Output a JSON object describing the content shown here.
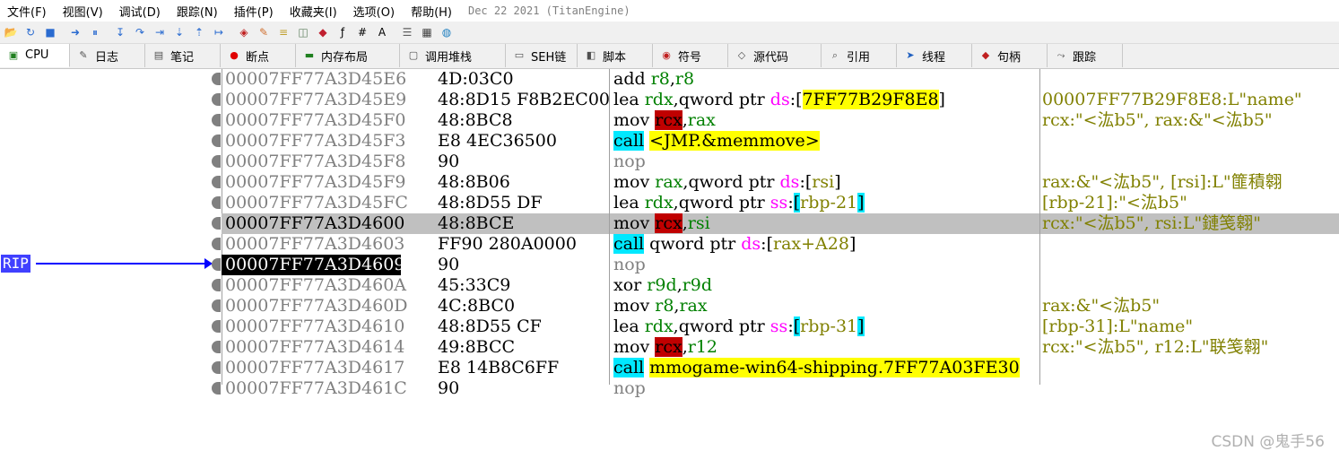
{
  "menu": {
    "items": [
      "文件(F)",
      "视图(V)",
      "调试(D)",
      "跟踪(N)",
      "插件(P)",
      "收藏夹(I)",
      "选项(O)",
      "帮助(H)"
    ],
    "title": "Dec 22 2021 (TitanEngine)"
  },
  "toolbar": {
    "icons": [
      "open-icon",
      "restart-icon",
      "stop-icon",
      "run-icon",
      "pause-icon",
      "step-into-icon",
      "step-over-icon",
      "trace-into-icon",
      "trace-over-icon",
      "execute-till-return-icon",
      "run-to-user-code-icon",
      "scylla-icon",
      "patch-icon",
      "comment-icon",
      "label-icon",
      "bookmark-icon",
      "function-icon",
      "hash-icon",
      "font-icon",
      "strings-icon",
      "calculator-icon",
      "globe-icon"
    ]
  },
  "tabs": [
    {
      "label": "CPU",
      "icon": "cpu-icon",
      "active": true
    },
    {
      "label": "日志",
      "icon": "log-icon",
      "active": false
    },
    {
      "label": "笔记",
      "icon": "notes-icon",
      "active": false
    },
    {
      "label": "断点",
      "icon": "breakpoint-icon",
      "active": false
    },
    {
      "label": "内存布局",
      "icon": "memory-icon",
      "active": false
    },
    {
      "label": "调用堆栈",
      "icon": "callstack-icon",
      "active": false
    },
    {
      "label": "SEH链",
      "icon": "seh-icon",
      "active": false
    },
    {
      "label": "脚本",
      "icon": "script-icon",
      "active": false
    },
    {
      "label": "符号",
      "icon": "symbols-icon",
      "active": false
    },
    {
      "label": "源代码",
      "icon": "source-icon",
      "active": false
    },
    {
      "label": "引用",
      "icon": "references-icon",
      "active": false
    },
    {
      "label": "线程",
      "icon": "threads-icon",
      "active": false
    },
    {
      "label": "句柄",
      "icon": "handles-icon",
      "active": false
    },
    {
      "label": "跟踪",
      "icon": "trace-icon",
      "active": false
    }
  ],
  "rip_label": "RIP",
  "rows": [
    {
      "addr": "00007FF77A3D45E6",
      "bytes": "4D:03C0",
      "dis": [
        [
          "mn",
          "add"
        ],
        [
          "sp",
          " "
        ],
        [
          "reg",
          "r8"
        ],
        [
          "pl",
          ","
        ],
        [
          "reg",
          "r8"
        ]
      ],
      "comment": ""
    },
    {
      "addr": "00007FF77A3D45E9",
      "bytes": "48:8D15 F8B2EC00",
      "dis": [
        [
          "mn",
          "lea"
        ],
        [
          "sp",
          " "
        ],
        [
          "reg",
          "rdx"
        ],
        [
          "pl",
          ","
        ],
        [
          "pl",
          "qword ptr "
        ],
        [
          "seg",
          "ds"
        ],
        [
          "pl",
          ":["
        ],
        [
          "imm",
          "7FF77B29F8E8"
        ],
        [
          "pl",
          "]"
        ]
      ],
      "comment": "00007FF77B29F8E8:L\"name\""
    },
    {
      "addr": "00007FF77A3D45F0",
      "bytes": "48:8BC8",
      "dis": [
        [
          "mn",
          "mov"
        ],
        [
          "sp",
          " "
        ],
        [
          "reghl",
          "rcx"
        ],
        [
          "pl",
          ","
        ],
        [
          "reg",
          "rax"
        ]
      ],
      "comment": "rcx:\"<汯b5\", rax:&\"<汯b5\""
    },
    {
      "addr": "00007FF77A3D45F3",
      "bytes": "E8 4EC36500",
      "dis": [
        [
          "call",
          "call"
        ],
        [
          "sp",
          " "
        ],
        [
          "sym",
          "<JMP.&memmove>"
        ]
      ],
      "comment": ""
    },
    {
      "addr": "00007FF77A3D45F8",
      "bytes": "90",
      "dis": [
        [
          "nop",
          "nop"
        ]
      ],
      "comment": ""
    },
    {
      "addr": "00007FF77A3D45F9",
      "bytes": "48:8B06",
      "dis": [
        [
          "mn",
          "mov"
        ],
        [
          "sp",
          " "
        ],
        [
          "reg",
          "rax"
        ],
        [
          "pl",
          ","
        ],
        [
          "pl",
          "qword ptr "
        ],
        [
          "seg",
          "ds"
        ],
        [
          "pl",
          ":["
        ],
        [
          "mem",
          "rsi"
        ],
        [
          "pl",
          "]"
        ]
      ],
      "comment": "rax:&\"<汯b5\", [rsi]:L\"篚積翱"
    },
    {
      "addr": "00007FF77A3D45FC",
      "bytes": "48:8D55 DF",
      "dis": [
        [
          "mn",
          "lea"
        ],
        [
          "sp",
          " "
        ],
        [
          "reg",
          "rdx"
        ],
        [
          "pl",
          ","
        ],
        [
          "pl",
          "qword ptr "
        ],
        [
          "seg",
          "ss"
        ],
        [
          "pl",
          ":"
        ],
        [
          "brk",
          "["
        ],
        [
          "mem",
          "rbp-21"
        ],
        [
          "brk",
          "]"
        ]
      ],
      "comment": "[rbp-21]:\"<汯b5\""
    },
    {
      "addr": "00007FF77A3D4600",
      "bytes": "48:8BCE",
      "sel": true,
      "dis": [
        [
          "mn",
          "mov"
        ],
        [
          "sp",
          " "
        ],
        [
          "reghl",
          "rcx"
        ],
        [
          "pl",
          ","
        ],
        [
          "reg",
          "rsi"
        ]
      ],
      "comment": "rcx:\"<汯b5\", rsi:L\"鏈笺翱\""
    },
    {
      "addr": "00007FF77A3D4603",
      "bytes": "FF90 280A0000",
      "dis": [
        [
          "call",
          "call"
        ],
        [
          "sp",
          " "
        ],
        [
          "pl",
          "qword ptr "
        ],
        [
          "seg",
          "ds"
        ],
        [
          "pl",
          ":["
        ],
        [
          "mem",
          "rax+A28"
        ],
        [
          "pl",
          "]"
        ]
      ],
      "comment": ""
    },
    {
      "addr": "00007FF77A3D4609",
      "bytes": "90",
      "cur": true,
      "dis": [
        [
          "nop",
          "nop"
        ]
      ],
      "comment": ""
    },
    {
      "addr": "00007FF77A3D460A",
      "bytes": "45:33C9",
      "dis": [
        [
          "mn",
          "xor"
        ],
        [
          "sp",
          " "
        ],
        [
          "reg",
          "r9d"
        ],
        [
          "pl",
          ","
        ],
        [
          "reg",
          "r9d"
        ]
      ],
      "comment": ""
    },
    {
      "addr": "00007FF77A3D460D",
      "bytes": "4C:8BC0",
      "dis": [
        [
          "mn",
          "mov"
        ],
        [
          "sp",
          " "
        ],
        [
          "reg",
          "r8"
        ],
        [
          "pl",
          ","
        ],
        [
          "reg",
          "rax"
        ]
      ],
      "comment": "rax:&\"<汯b5\""
    },
    {
      "addr": "00007FF77A3D4610",
      "bytes": "48:8D55 CF",
      "dis": [
        [
          "mn",
          "lea"
        ],
        [
          "sp",
          " "
        ],
        [
          "reg",
          "rdx"
        ],
        [
          "pl",
          ","
        ],
        [
          "pl",
          "qword ptr "
        ],
        [
          "seg",
          "ss"
        ],
        [
          "pl",
          ":"
        ],
        [
          "brk",
          "["
        ],
        [
          "mem",
          "rbp-31"
        ],
        [
          "brk",
          "]"
        ]
      ],
      "comment": "[rbp-31]:L\"name\""
    },
    {
      "addr": "00007FF77A3D4614",
      "bytes": "49:8BCC",
      "dis": [
        [
          "mn",
          "mov"
        ],
        [
          "sp",
          " "
        ],
        [
          "reghl",
          "rcx"
        ],
        [
          "pl",
          ","
        ],
        [
          "reg",
          "r12"
        ]
      ],
      "comment": "rcx:\"<汯b5\", r12:L\"联笺翱\""
    },
    {
      "addr": "00007FF77A3D4617",
      "bytes": "E8 14B8C6FF",
      "dis": [
        [
          "call",
          "call"
        ],
        [
          "sp",
          " "
        ],
        [
          "sym",
          "mmogame-win64-shipping.7FF77A03FE30"
        ]
      ],
      "comment": ""
    },
    {
      "addr": "00007FF77A3D461C",
      "bytes": "90",
      "dis": [
        [
          "nop",
          "nop"
        ]
      ],
      "comment": ""
    }
  ],
  "watermark": "CSDN @鬼手56"
}
